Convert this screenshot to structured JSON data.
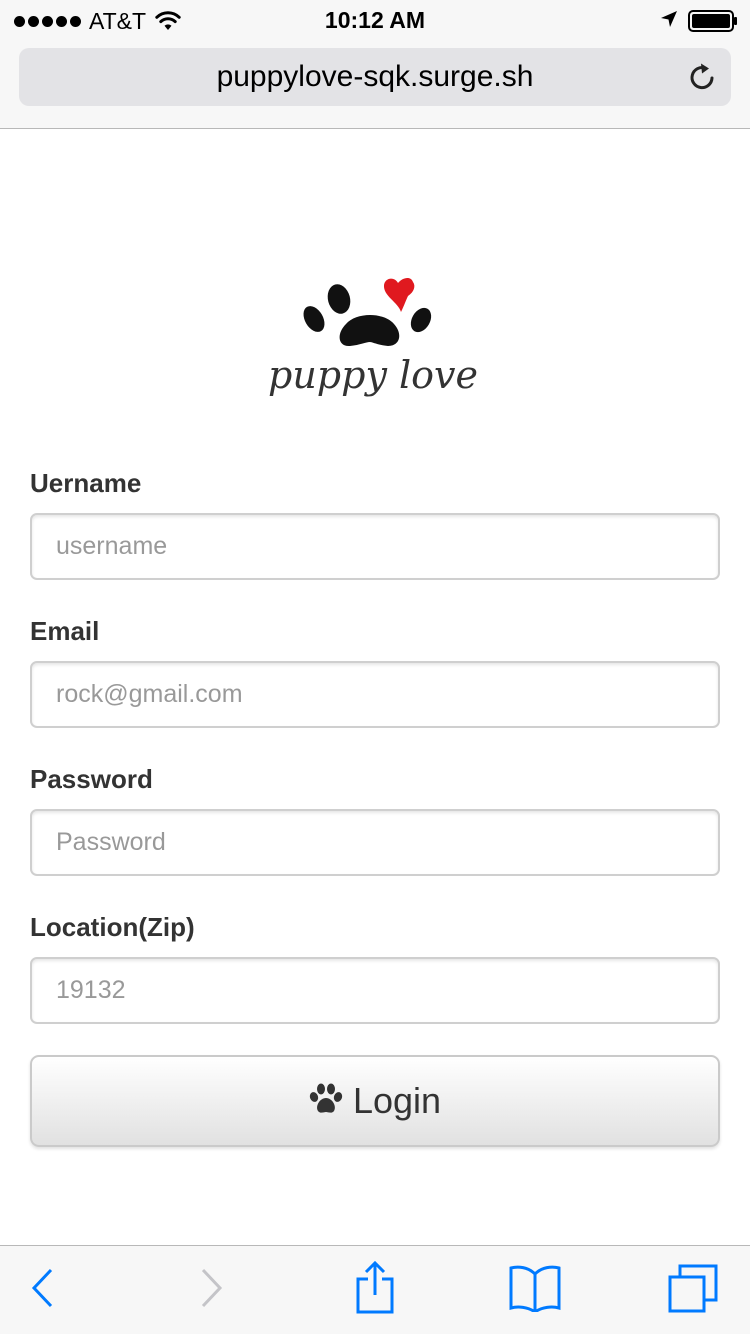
{
  "status_bar": {
    "carrier": "AT&T",
    "time": "10:12 AM",
    "signal_bars": 5,
    "icons": [
      "signal-dots-icon",
      "wifi-icon",
      "location-arrow-icon",
      "battery-icon"
    ]
  },
  "browser": {
    "url": "puppylove-sqk.surge.sh",
    "accent_color": "#007aff"
  },
  "logo": {
    "text": "puppy love",
    "icon": "paw-heart-logo",
    "heart_color": "#e0191f"
  },
  "form": {
    "username": {
      "label": "Uername",
      "placeholder": "username"
    },
    "email": {
      "label": "Email",
      "placeholder": "rock@gmail.com"
    },
    "password": {
      "label": "Password",
      "placeholder": "Password"
    },
    "location": {
      "label": "Location(Zip)",
      "placeholder": "19132"
    },
    "login_button": {
      "label": "Login",
      "icon": "paw-icon"
    }
  },
  "toolbar": {
    "items": [
      "back-icon",
      "forward-icon",
      "share-icon",
      "bookmarks-icon",
      "tabs-icon"
    ]
  }
}
